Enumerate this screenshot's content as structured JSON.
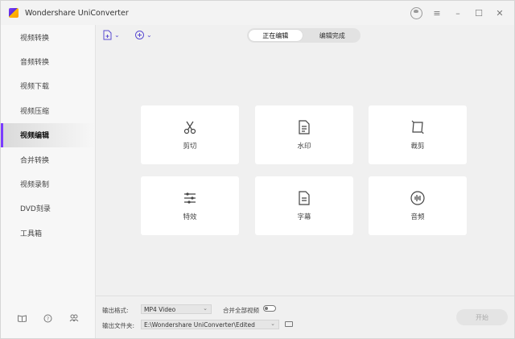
{
  "app": {
    "title": "Wondershare UniConverter"
  },
  "sidebar": {
    "items": [
      {
        "label": "视频转换"
      },
      {
        "label": "音频转换"
      },
      {
        "label": "视频下载"
      },
      {
        "label": "视频压缩"
      },
      {
        "label": "视频编辑",
        "active": true
      },
      {
        "label": "合并转换"
      },
      {
        "label": "视频录制"
      },
      {
        "label": "DVD刻录"
      },
      {
        "label": "工具箱"
      }
    ]
  },
  "segmented": {
    "left": "正在编辑",
    "right": "编辑完成"
  },
  "tools": [
    {
      "label": "剪切",
      "icon": "scissors-icon"
    },
    {
      "label": "水印",
      "icon": "watermark-icon"
    },
    {
      "label": "裁剪",
      "icon": "crop-icon"
    },
    {
      "label": "特效",
      "icon": "effects-icon"
    },
    {
      "label": "字幕",
      "icon": "subtitle-icon"
    },
    {
      "label": "音频",
      "icon": "audio-icon"
    }
  ],
  "footer": {
    "output_format_label": "输出格式:",
    "output_format_value": "MP4 Video",
    "merge_label": "合并全部视频",
    "output_folder_label": "输出文件夹:",
    "output_folder_value": "E:\\Wondershare UniConverter\\Edited",
    "start_label": "开始"
  },
  "colors": {
    "accent": "#7b3cff",
    "toolbar_icon": "#5a4bd1"
  }
}
